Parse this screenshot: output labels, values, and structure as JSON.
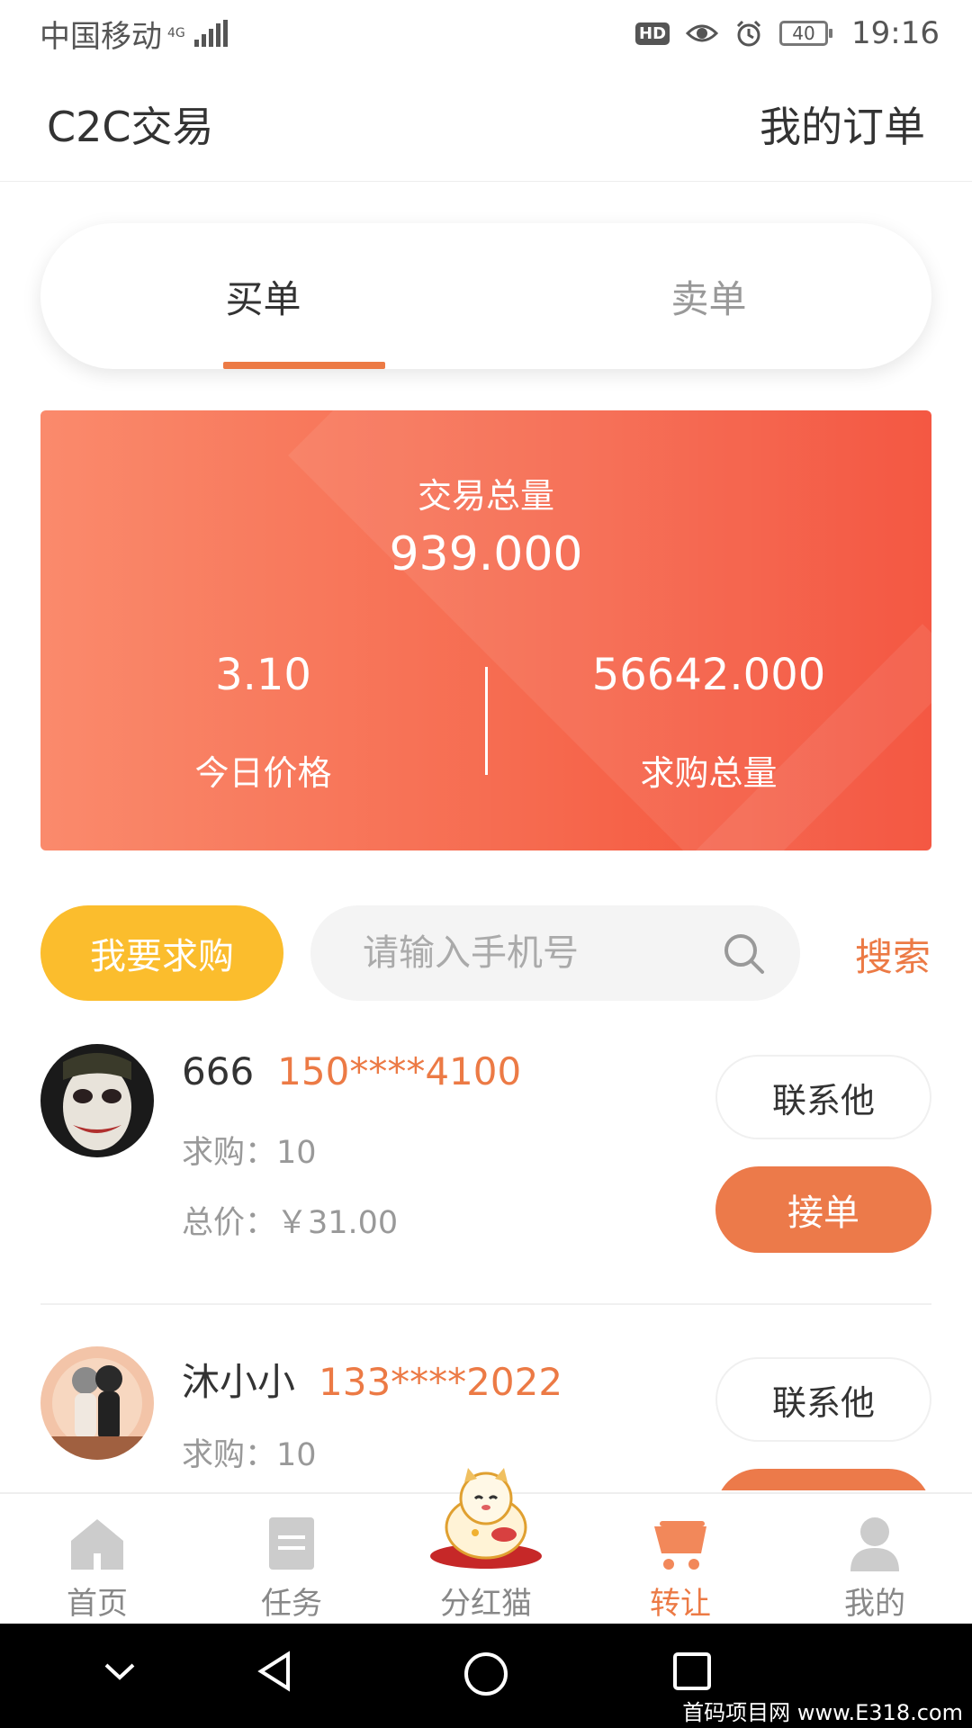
{
  "status_bar": {
    "carrier": "中国移动",
    "network": "4G",
    "hd": "HD",
    "battery": "40",
    "time": "19:16"
  },
  "header": {
    "title": "C2C交易",
    "orders_link": "我的订单"
  },
  "tabs": [
    {
      "label": "买单",
      "active": true
    },
    {
      "label": "卖单",
      "active": false
    }
  ],
  "stats": {
    "total_label": "交易总量",
    "total_value": "939.000",
    "price_value": "3.10",
    "price_label": "今日价格",
    "demand_value": "56642.000",
    "demand_label": "求购总量"
  },
  "actions": {
    "want_buy": "我要求购",
    "search_placeholder": "请输入手机号",
    "search_label": "搜索"
  },
  "orders": [
    {
      "name": "666",
      "phone": "150****4100",
      "qty": "求购：10",
      "total": "总价：￥31.00",
      "contact": "联系他",
      "accept": "接单"
    },
    {
      "name": "沐小小",
      "phone": "133****2022",
      "qty": "求购：10",
      "contact": "联系他"
    }
  ],
  "bottom_nav": [
    {
      "label": "首页",
      "icon": "home-icon",
      "active": false
    },
    {
      "label": "任务",
      "icon": "task-icon",
      "active": false
    },
    {
      "label": "分红猫",
      "icon": "lucky-cat-icon",
      "active": false
    },
    {
      "label": "转让",
      "icon": "cart-icon",
      "active": true
    },
    {
      "label": "我的",
      "icon": "user-icon",
      "active": false
    }
  ],
  "watermark": "首码项目网 www.E318.com",
  "colors": {
    "accent": "#ec7a45",
    "yellow_button": "#fbbd2d",
    "card_gradient_start": "#fa8a6c",
    "card_gradient_end": "#f44a33"
  }
}
